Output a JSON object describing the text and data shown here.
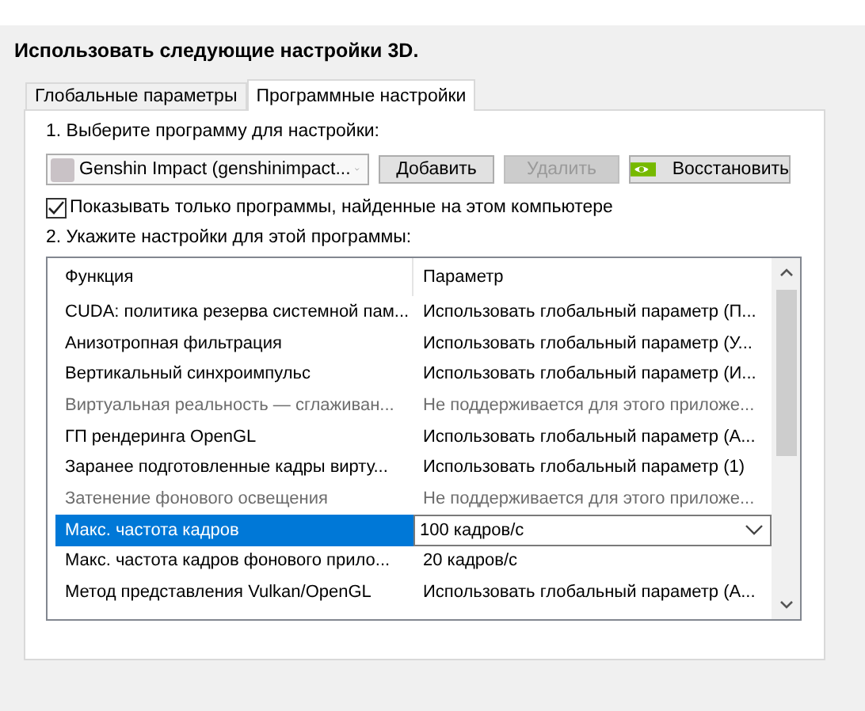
{
  "heading": "Использовать следующие настройки 3D.",
  "tabs": [
    {
      "label": "Глобальные параметры",
      "selected": false
    },
    {
      "label": "Программные настройки",
      "selected": true
    }
  ],
  "step1": "1. Выберите программу для настройки:",
  "program_select": {
    "value": "Genshin Impact (genshinimpact..."
  },
  "buttons": [
    {
      "label": "Добавить",
      "disabled": false,
      "kind": "plain"
    },
    {
      "label": "Удалить",
      "disabled": true,
      "kind": "plain"
    },
    {
      "label": "Восстановить",
      "disabled": false,
      "kind": "logo"
    }
  ],
  "show_only_checkbox": {
    "label": "Показывать только программы, найденные на этом компьютере",
    "checked": true
  },
  "step2": "2. Укажите настройки для этой программы:",
  "table": {
    "columns": [
      "Функция",
      "Параметр"
    ],
    "rows": [
      {
        "feature": "CUDA: политика резерва системной пам...",
        "value": "Использовать глобальный параметр (П...",
        "disabled": false,
        "selected": false
      },
      {
        "feature": "Анизотропная фильтрация",
        "value": "Использовать глобальный параметр (У...",
        "disabled": false,
        "selected": false
      },
      {
        "feature": "Вертикальный синхроимпульс",
        "value": "Использовать глобальный параметр (И...",
        "disabled": false,
        "selected": false
      },
      {
        "feature": "Виртуальная реальность — сглаживан...",
        "value": "Не поддерживается для этого приложе...",
        "disabled": true,
        "selected": false
      },
      {
        "feature": "ГП рендеринга OpenGL",
        "value": "Использовать глобальный параметр (А...",
        "disabled": false,
        "selected": false
      },
      {
        "feature": "Заранее подготовленные кадры вирту...",
        "value": "Использовать глобальный параметр (1)",
        "disabled": false,
        "selected": false
      },
      {
        "feature": "Затенение фонового освещения",
        "value": "Не поддерживается для этого приложе...",
        "disabled": true,
        "selected": false
      },
      {
        "feature": "Макс. частота кадров",
        "value": "100 кадров/с",
        "disabled": false,
        "selected": true
      },
      {
        "feature": "Макс. частота кадров фонового прило...",
        "value": "20 кадров/с",
        "disabled": false,
        "selected": false
      },
      {
        "feature": "Метод представления Vulkan/OpenGL",
        "value": "Использовать глобальный параметр (А...",
        "disabled": false,
        "selected": false
      }
    ]
  }
}
